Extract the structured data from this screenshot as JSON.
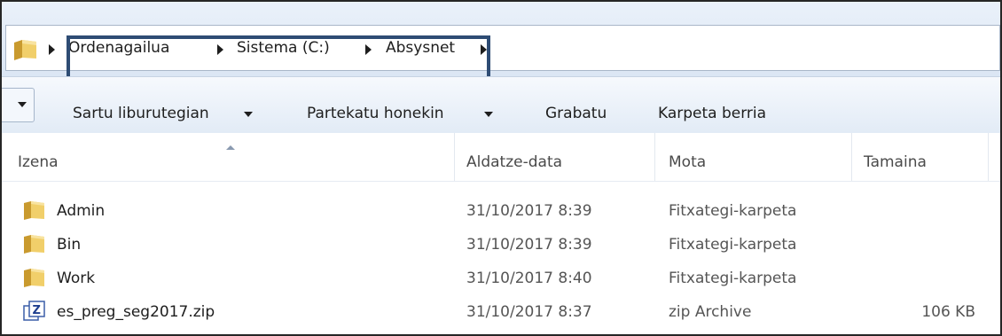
{
  "address_bar": {
    "crumbs": [
      "Ordenagailua",
      "Sistema (C:)",
      "Absysnet"
    ]
  },
  "toolbar": {
    "include_library": "Sartu liburutegian",
    "share_with": "Partekatu honekin",
    "burn": "Grabatu",
    "new_folder": "Karpeta berria"
  },
  "columns": {
    "name": "Izena",
    "date": "Aldatze-data",
    "type": "Mota",
    "size": "Tamaina"
  },
  "files": [
    {
      "name": "Admin",
      "date": "31/10/2017 8:39",
      "type": "Fitxategi-karpeta",
      "size": "",
      "icon": "folder-icon"
    },
    {
      "name": "Bin",
      "date": "31/10/2017 8:39",
      "type": "Fitxategi-karpeta",
      "size": "",
      "icon": "folder-icon"
    },
    {
      "name": "Work",
      "date": "31/10/2017 8:40",
      "type": "Fitxategi-karpeta",
      "size": "",
      "icon": "folder-icon"
    },
    {
      "name": "es_preg_seg2017.zip",
      "date": "31/10/2017 8:37",
      "type": "zip Archive",
      "size": "106 KB",
      "icon": "zip-file-icon"
    }
  ],
  "colors": {
    "highlight_border": "#2e4c74",
    "toolbar_gradient_top": "#f6f9fd",
    "toolbar_gradient_bottom": "#e2ebf6",
    "folder_yellow": "#e9c25a"
  }
}
